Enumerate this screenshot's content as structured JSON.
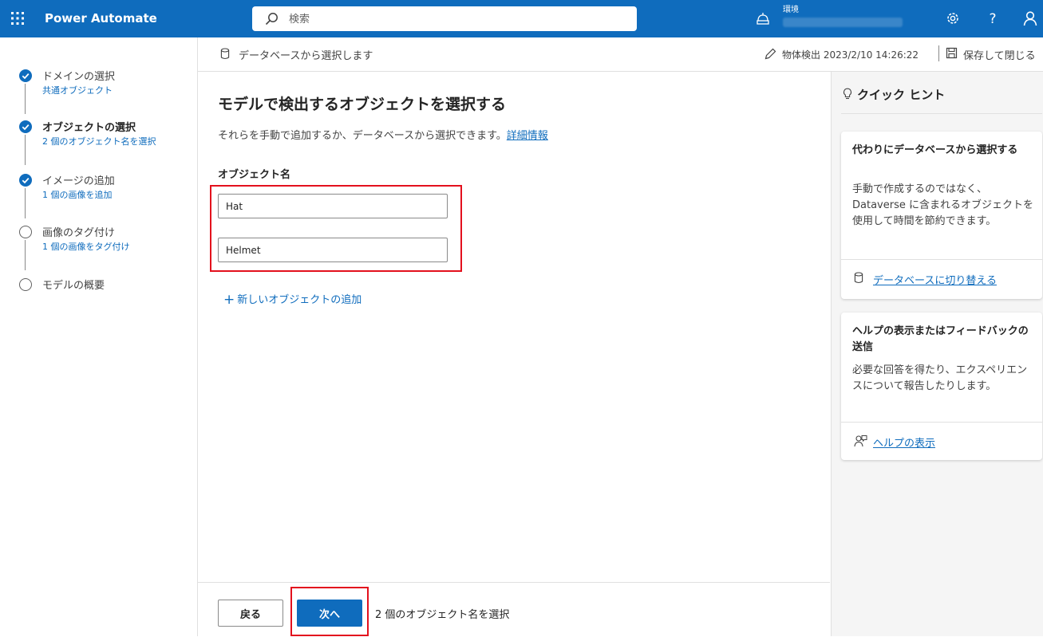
{
  "header": {
    "app_name": "Power Automate",
    "search_placeholder": "検索",
    "environment_label": "環境"
  },
  "steps": [
    {
      "title": "ドメインの選択",
      "subtitle": "共通オブジェクト",
      "state": "done"
    },
    {
      "title": "オブジェクトの選択",
      "subtitle": "2 個のオブジェクト名を選択",
      "state": "done-active"
    },
    {
      "title": "イメージの追加",
      "subtitle": "1 個の画像を追加",
      "state": "done"
    },
    {
      "title": "画像のタグ付け",
      "subtitle": "1 個の画像をタグ付け",
      "state": "todo"
    },
    {
      "title": "モデルの概要",
      "subtitle": "",
      "state": "todo"
    }
  ],
  "commandbar": {
    "select_from_db": "データベースから選択します",
    "model_name": "物体検出 2023/2/10 14:26:22",
    "save_close": "保存して閉じる"
  },
  "main": {
    "title": "モデルで検出するオブジェクトを選択する",
    "description": "それらを手動で追加するか、データベースから選択できます。",
    "learn_more": "詳細情報",
    "field_label": "オブジェクト名",
    "objects": [
      "Hat",
      "Helmet"
    ],
    "add_object": "新しいオブジェクトの追加"
  },
  "footer": {
    "back": "戻る",
    "next": "次へ",
    "status": "2 個のオブジェクト名を選択"
  },
  "hints": {
    "title": "クイック ヒント",
    "card1": {
      "title": "代わりにデータベースから選択する",
      "body": "手動で作成するのではなく、Dataverse に含まれるオブジェクトを使用して時間を節約できます。",
      "link": "データベースに切り替える"
    },
    "card2": {
      "title": "ヘルプの表示またはフィードバックの送信",
      "body": "必要な回答を得たり、エクスペリエンスについて報告したりします。",
      "link": "ヘルプの表示"
    }
  },
  "colors": {
    "brand": "#0f6cbd",
    "highlight": "#e3101d"
  }
}
